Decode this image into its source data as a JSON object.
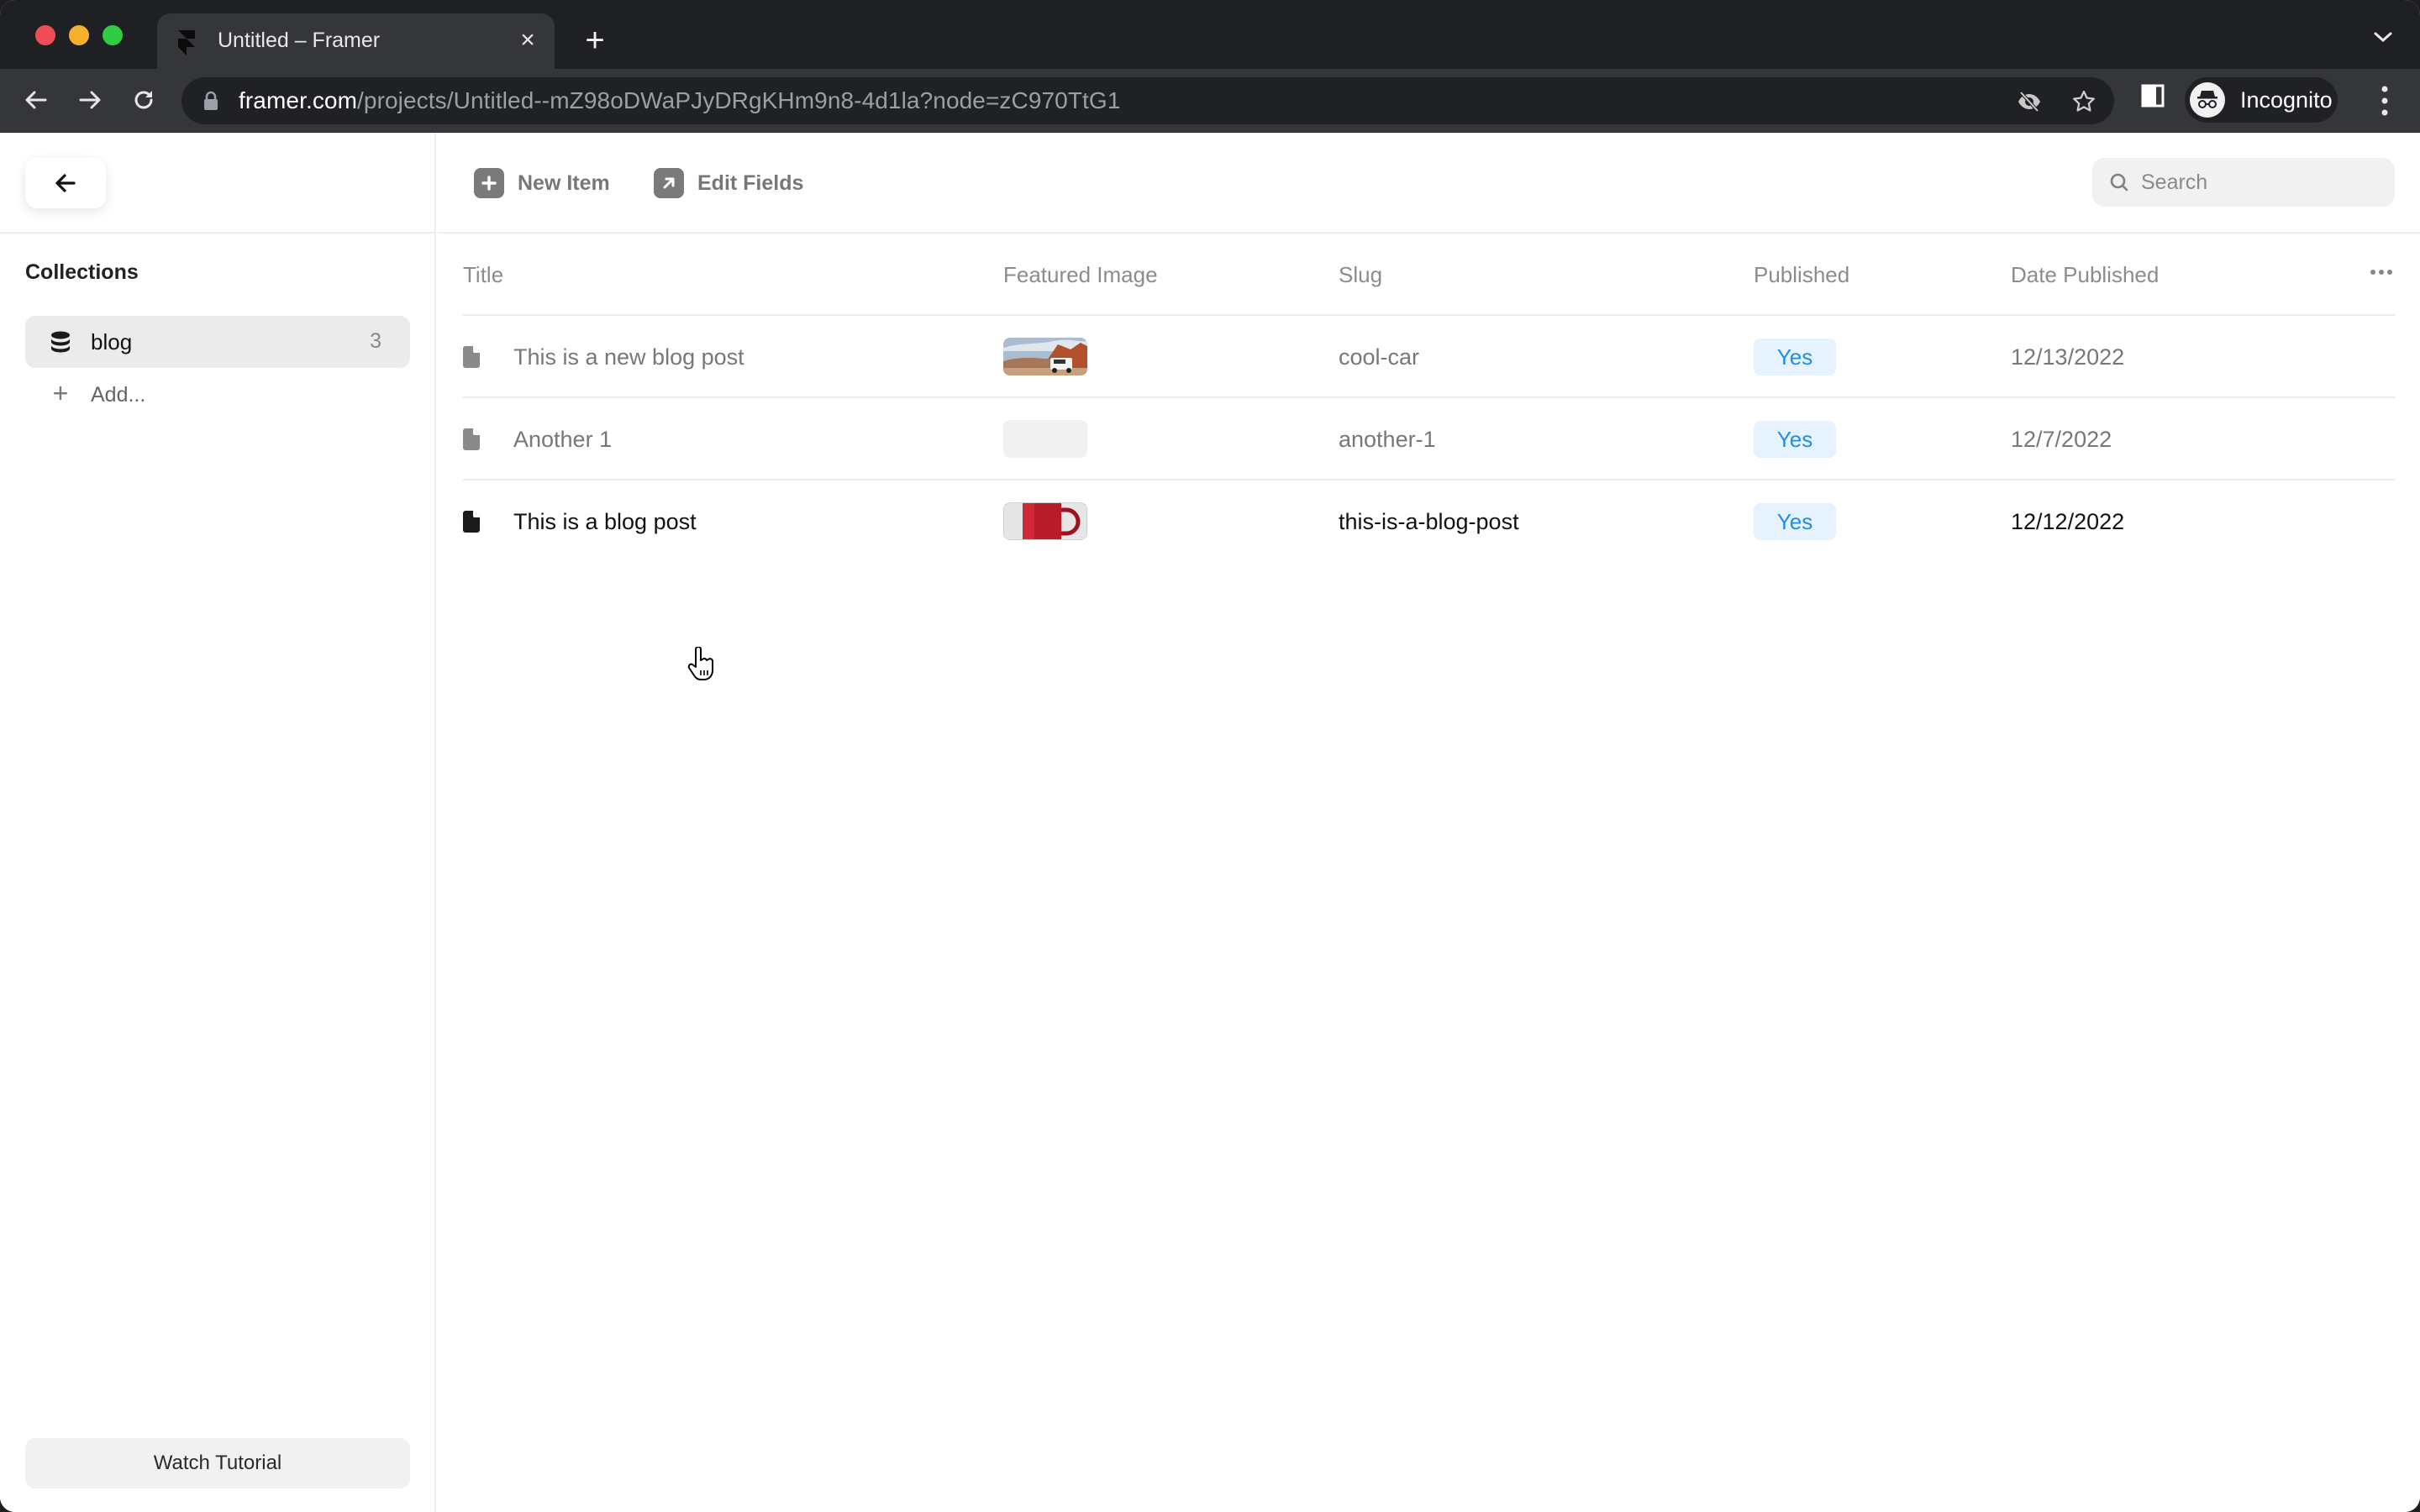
{
  "browser": {
    "tab": {
      "title": "Untitled – Framer",
      "favicon": "framer-logo-icon",
      "close": "×"
    },
    "new_tab": "+",
    "url_host": "framer.com",
    "url_path": "/projects/Untitled--mZ98oDWaPJyDRgKHm9n8-4d1la?node=zC970TtG1",
    "profile_label": "Incognito",
    "icons": [
      "back-arrow-icon",
      "forward-arrow-icon",
      "reload-icon",
      "lock-icon",
      "eye-slash-icon",
      "star-icon",
      "sidebar-toggle-icon",
      "incognito-icon",
      "more-vert-icon",
      "tab-list-chevron-icon"
    ]
  },
  "sidebar": {
    "back_icon": "arrow-left-icon",
    "heading": "Collections",
    "collections": [
      {
        "label": "blog",
        "count": "3",
        "icon": "database-icon",
        "selected": true
      }
    ],
    "add_label": "Add...",
    "tutorial_label": "Watch Tutorial"
  },
  "toolbar": {
    "new_item_label": "New Item",
    "edit_fields_label": "Edit Fields",
    "search_placeholder": "Search"
  },
  "table": {
    "columns": [
      "Title",
      "Featured Image",
      "Slug",
      "Published",
      "Date Published"
    ],
    "rows": [
      {
        "title": "This is a new blog post",
        "image": "car-in-desert",
        "slug": "cool-car",
        "published": "Yes",
        "date": "12/13/2022",
        "hover": false
      },
      {
        "title": "Another 1",
        "image": "empty",
        "slug": "another-1",
        "published": "Yes",
        "date": "12/7/2022",
        "hover": false
      },
      {
        "title": "This is a blog post",
        "image": "red-mug",
        "slug": "this-is-a-blog-post",
        "published": "Yes",
        "date": "12/12/2022",
        "hover": true
      }
    ]
  },
  "colors": {
    "badge_bg": "#e6f2fd",
    "badge_text": "#1f8fe6",
    "chrome_dark": "#1f2023",
    "chrome_tab": "#35363a"
  }
}
